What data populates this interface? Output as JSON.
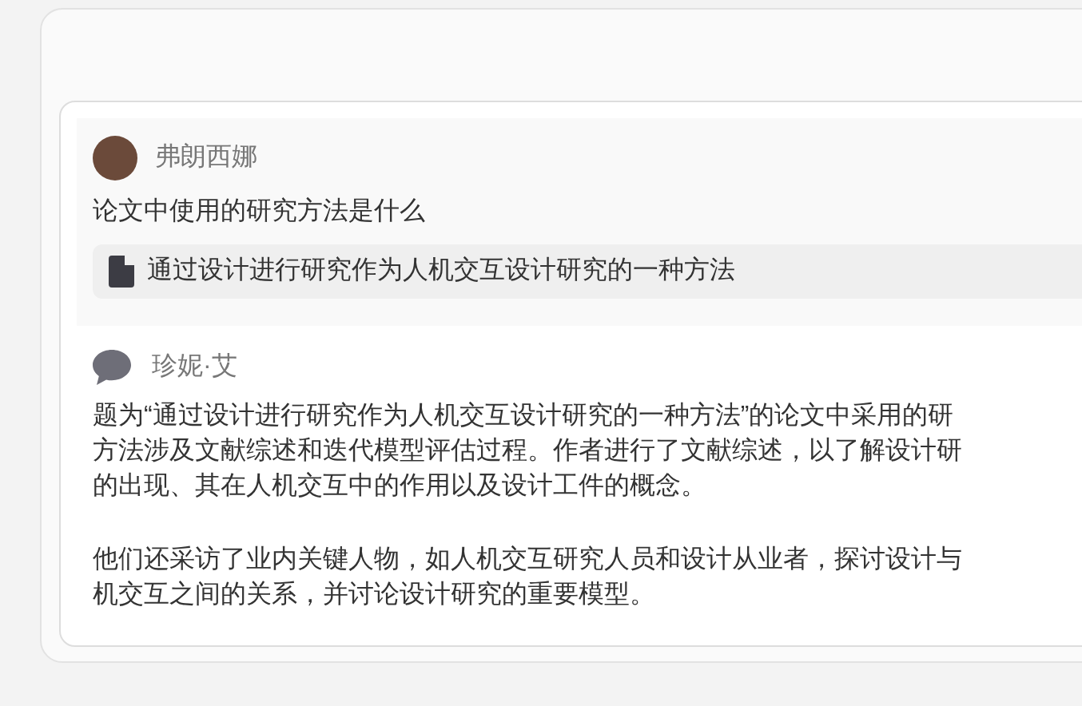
{
  "question": {
    "author": "弗朗西娜",
    "text": "论文中使用的研究方法是什么",
    "attachment": "通过设计进行研究作为人机交互设计研究的一种方法"
  },
  "answer": {
    "author": "珍妮·艾",
    "paragraphs": [
      [
        "题为“通过设计进行研究作为人机交互设计研究的一种方法”的论文中采用的研",
        "方法涉及文献综述和迭代模型评估过程。作者进行了文献综述，以了解设计研",
        "的出现、其在人机交互中的作用以及设计工件的概念。"
      ],
      [
        "他们还采访了业内关键人物，如人机交互研究人员和设计从业者，探讨设计与",
        "机交互之间的关系，并讨论设计研究的重要模型。"
      ]
    ]
  }
}
